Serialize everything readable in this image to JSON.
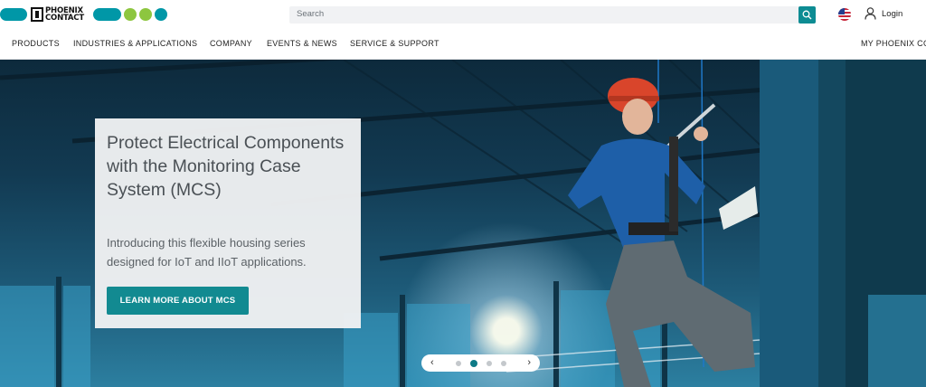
{
  "header": {
    "logo_text_line1": "PHOENIX",
    "logo_text_line2": "CONTACT",
    "search_placeholder": "Search",
    "login_label": "Login",
    "brand_color": "#0097a7",
    "accent_green": "#8dc63f"
  },
  "nav": {
    "items": [
      {
        "label": "PRODUCTS"
      },
      {
        "label": "INDUSTRIES & APPLICATIONS"
      },
      {
        "label": "COMPANY"
      },
      {
        "label": "EVENTS & NEWS"
      },
      {
        "label": "SERVICE & SUPPORT"
      }
    ],
    "my_account_label": "MY PHOENIX CO"
  },
  "hero": {
    "title": "Protect Electrical Components with the Monitoring Case System (MCS)",
    "subtitle": "Introducing this flexible housing series designed for IoT and IIoT applications.",
    "cta_label": "LEARN MORE ABOUT MCS",
    "cta_color": "#128a91",
    "carousel": {
      "prev_glyph": "‹",
      "next_glyph": "›",
      "slide_count": 4,
      "active_slide": 2
    }
  }
}
